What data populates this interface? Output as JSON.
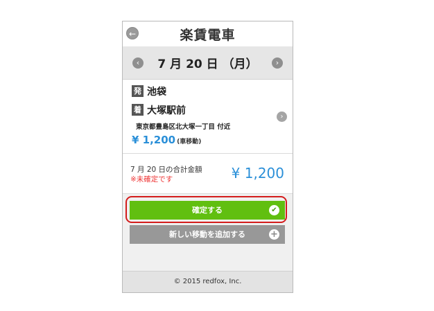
{
  "header": {
    "back_icon": "arrow-left-icon",
    "title": "楽賃電車"
  },
  "date_bar": {
    "prev_icon": "chevron-left-icon",
    "date": "7 月 20 日 （月）",
    "next_icon": "chevron-right-icon"
  },
  "trip": {
    "departure_badge": "発",
    "departure": "池袋",
    "arrival_badge": "着",
    "arrival": "大塚駅前",
    "address": "東京都豊島区北大塚一丁目 付近",
    "fare": "¥ 1,200",
    "fare_note": "(車移動)",
    "chevron_icon": "chevron-right-icon"
  },
  "total": {
    "label": "7 月 20 日の合計金額",
    "status": "※未確定です",
    "amount": "¥ 1,200"
  },
  "actions": {
    "confirm_label": "確定する",
    "confirm_icon": "check-icon",
    "add_label": "新しい移動を追加する",
    "add_icon": "plus-icon"
  },
  "footer": {
    "copyright": "© 2015 redfox, Inc."
  },
  "colors": {
    "accent_blue": "#2a8fd8",
    "confirm_green": "#61bf10",
    "warning_red": "#e33333",
    "highlight_red": "#d41c1c",
    "add_gray": "#989898"
  }
}
